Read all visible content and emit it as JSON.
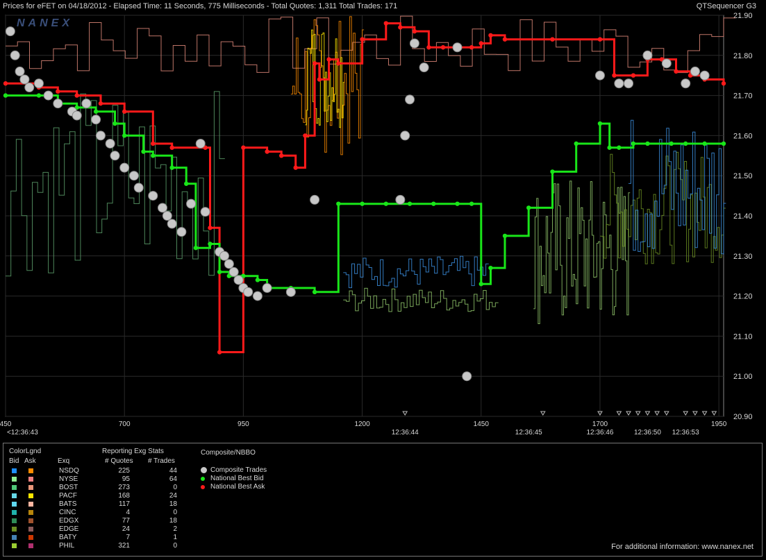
{
  "header": {
    "title": "Prices for  eFET  on  04/18/2012  - Elapsed Time: 11 Seconds, 775 Milliseconds  -  Total Quotes: 1,311  Total Trades: 171",
    "app_name": "QTSequencer G3",
    "watermark": "NANEX"
  },
  "colors": {
    "bid_green": "#19e619",
    "ask_red": "#ff1a1a",
    "trade_gray": "#c8c8c8",
    "orange": "#ff8c00",
    "yellow": "#ffe600",
    "blue": "#3b8fe0",
    "salmon": "#e08a7a"
  },
  "chart_data": {
    "type": "line",
    "title": "",
    "xlabel": "",
    "ylabel": "",
    "xlim": [
      450,
      1960
    ],
    "ylim": [
      20.9,
      21.9
    ],
    "x_ticks": [
      450,
      700,
      950,
      1200,
      1450,
      1700,
      1950
    ],
    "y_ticks": [
      "20.90",
      "21.00",
      "21.10",
      "21.20",
      "21.30",
      "21.40",
      "21.50",
      "21.60",
      "21.70",
      "21.80",
      "21.90"
    ],
    "time_labels": [
      {
        "x": 450,
        "label": "<12:36:43"
      },
      {
        "x": 1290,
        "label": "12:36:44"
      },
      {
        "x": 1550,
        "label": "12:36:45"
      },
      {
        "x": 1700,
        "label": "12:36:46"
      },
      {
        "x": 1800,
        "label": "12:36:50"
      },
      {
        "x": 1880,
        "label": "12:36:53"
      }
    ],
    "series": [
      {
        "name": "National Best Ask",
        "x": [
          450,
          520,
          560,
          600,
          650,
          700,
          760,
          800,
          870,
          880,
          900,
          950,
          1000,
          1030,
          1060,
          1080,
          1100,
          1110,
          1130,
          1150,
          1200,
          1250,
          1280,
          1310,
          1340,
          1370,
          1400,
          1430,
          1450,
          1470,
          1500,
          1600,
          1700,
          1730,
          1770,
          1800,
          1830,
          1860,
          1890,
          1920,
          1960
        ],
        "values": [
          21.73,
          21.72,
          21.71,
          21.7,
          21.68,
          21.66,
          21.58,
          21.57,
          21.57,
          21.37,
          21.06,
          21.57,
          21.56,
          21.55,
          21.52,
          21.6,
          21.78,
          21.74,
          21.79,
          21.78,
          21.84,
          21.88,
          21.87,
          21.86,
          21.82,
          21.82,
          21.82,
          21.82,
          21.83,
          21.85,
          21.84,
          21.84,
          21.84,
          21.75,
          21.75,
          21.79,
          21.79,
          21.76,
          21.75,
          21.74,
          21.73
        ]
      },
      {
        "name": "National Best Bid",
        "x": [
          450,
          520,
          560,
          600,
          640,
          680,
          700,
          740,
          760,
          800,
          830,
          850,
          880,
          900,
          920,
          950,
          980,
          1000,
          1050,
          1100,
          1150,
          1200,
          1250,
          1300,
          1350,
          1400,
          1430,
          1450,
          1470,
          1500,
          1550,
          1600,
          1650,
          1700,
          1720,
          1740,
          1770,
          1800,
          1850,
          1880,
          1920,
          1960
        ],
        "values": [
          21.7,
          21.7,
          21.68,
          21.67,
          21.66,
          21.63,
          21.6,
          21.56,
          21.55,
          21.52,
          21.48,
          21.32,
          21.33,
          21.26,
          21.25,
          21.25,
          21.24,
          21.22,
          21.22,
          21.21,
          21.43,
          21.43,
          21.43,
          21.43,
          21.43,
          21.43,
          21.43,
          21.23,
          21.27,
          21.35,
          21.42,
          21.51,
          21.58,
          21.63,
          21.57,
          21.57,
          21.58,
          21.58,
          21.58,
          21.58,
          21.58,
          21.58
        ]
      },
      {
        "name": "Composite Trades",
        "x": [
          460,
          470,
          480,
          490,
          500,
          520,
          540,
          560,
          590,
          600,
          620,
          640,
          650,
          670,
          680,
          700,
          720,
          730,
          760,
          780,
          790,
          800,
          820,
          840,
          860,
          870,
          900,
          910,
          920,
          930,
          940,
          950,
          960,
          980,
          1000,
          1050,
          1100,
          1280,
          1290,
          1300,
          1310,
          1330,
          1400,
          1420,
          1700,
          1740,
          1760,
          1800,
          1840,
          1880,
          1900,
          1920
        ],
        "values": [
          21.86,
          21.8,
          21.76,
          21.74,
          21.72,
          21.73,
          21.7,
          21.68,
          21.66,
          21.65,
          21.68,
          21.64,
          21.6,
          21.58,
          21.55,
          21.52,
          21.5,
          21.47,
          21.45,
          21.42,
          21.4,
          21.38,
          21.36,
          21.43,
          21.58,
          21.41,
          21.31,
          21.3,
          21.28,
          21.26,
          21.24,
          21.22,
          21.21,
          21.2,
          21.22,
          21.21,
          21.44,
          21.44,
          21.6,
          21.69,
          21.83,
          21.77,
          21.82,
          21.0,
          21.75,
          21.73,
          21.73,
          21.8,
          21.78,
          21.73,
          21.76,
          21.75
        ]
      }
    ]
  },
  "legend": {
    "color_legend_title": "ColorLgnd",
    "bid_header": "Bid",
    "ask_header": "Ask",
    "exq_header": "Exq",
    "stats_title": "Reporting Exg Stats",
    "quotes_header": "# Quotes",
    "trades_header": "# Trades",
    "rows": [
      {
        "exchange": "NSDQ",
        "quotes": "225",
        "trades": "44",
        "bid_color": "#1e8fff",
        "ask_color": "#ff8c00"
      },
      {
        "exchange": "NYSE",
        "quotes": "95",
        "trades": "64",
        "bid_color": "#90ee90",
        "ask_color": "#f08080"
      },
      {
        "exchange": "BOST",
        "quotes": "273",
        "trades": "0",
        "bid_color": "#50c878",
        "ask_color": "#e9967a"
      },
      {
        "exchange": "PACF",
        "quotes": "168",
        "trades": "24",
        "bid_color": "#66d9e8",
        "ask_color": "#ffe600"
      },
      {
        "exchange": "BATS",
        "quotes": "117",
        "trades": "18",
        "bid_color": "#5fd7f0",
        "ask_color": "#ffb6a0"
      },
      {
        "exchange": "CINC",
        "quotes": "4",
        "trades": "0",
        "bid_color": "#20b2aa",
        "ask_color": "#b8860b"
      },
      {
        "exchange": "EDGX",
        "quotes": "77",
        "trades": "18",
        "bid_color": "#2e8b57",
        "ask_color": "#a0522d"
      },
      {
        "exchange": "EDGE",
        "quotes": "24",
        "trades": "2",
        "bid_color": "#6b8e23",
        "ask_color": "#8b5a5a"
      },
      {
        "exchange": "BATY",
        "quotes": "7",
        "trades": "1",
        "bid_color": "#4682b4",
        "ask_color": "#cd3700"
      },
      {
        "exchange": "PHIL",
        "quotes": "321",
        "trades": "0",
        "bid_color": "#9acd32",
        "ask_color": "#b0306f"
      }
    ],
    "composite_title": "Composite/NBBO",
    "composite_items": [
      {
        "label": "Composite Trades",
        "color": "#c8c8c8"
      },
      {
        "label": "National Best Bid",
        "color": "#19e619"
      },
      {
        "label": "National Best Ask",
        "color": "#ff1a1a"
      }
    ]
  },
  "footer": {
    "info": "For additional information: www.nanex.net"
  }
}
